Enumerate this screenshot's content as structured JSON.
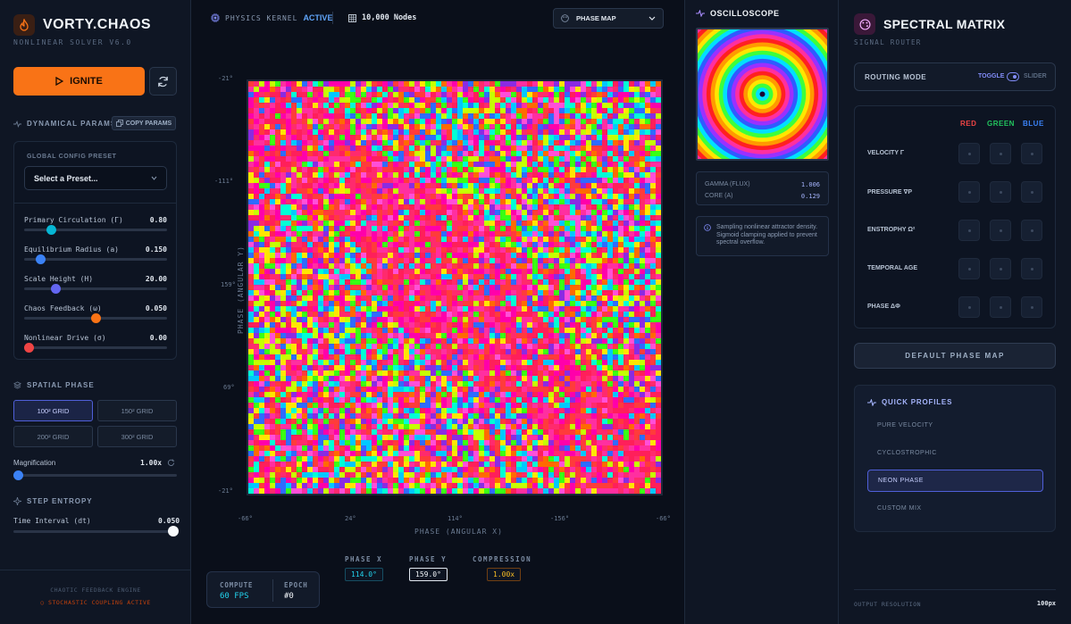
{
  "brand": {
    "title": "VORTY.CHAOS",
    "subtitle": "NONLINEAR SOLVER V6.0"
  },
  "controls": {
    "ignite_label": "IGNITE",
    "copy_params_label": "COPY PARAMS"
  },
  "sections": {
    "dynamical": "DYNAMICAL PARAMS",
    "spatial": "SPATIAL PHASE",
    "entropy": "STEP ENTROPY"
  },
  "preset": {
    "label": "GLOBAL CONFIG PRESET",
    "value": "Select a Preset..."
  },
  "params": [
    {
      "label": "Primary Circulation (Γ)",
      "value": "0.80",
      "fraction": 0.19,
      "color": "#06b6d4"
    },
    {
      "label": "Equilibrium Radius (a)",
      "value": "0.150",
      "fraction": 0.11,
      "color": "#3b82f6"
    },
    {
      "label": "Scale Height (H)",
      "value": "20.00",
      "fraction": 0.22,
      "color": "#6366f1"
    },
    {
      "label": "Chaos Feedback (ω)",
      "value": "0.050",
      "fraction": 0.5,
      "color": "#f97316"
    },
    {
      "label": "Nonlinear Drive (σ)",
      "value": "0.00",
      "fraction": 0.0,
      "color": "#ef4444"
    }
  ],
  "grid_options": [
    "100² GRID",
    "150² GRID",
    "200² GRID",
    "300² GRID"
  ],
  "magnification": {
    "label": "Magnification",
    "value": "1.00x",
    "fraction": 0.0
  },
  "time_interval": {
    "label": "Time Interval (dt)",
    "value": "0.050",
    "fraction": 1.0
  },
  "footer": {
    "line1": "CHAOTIC FEEDBACK ENGINE",
    "line2": "STOCHASTIC COUPLING ACTIVE"
  },
  "topbar": {
    "kernel_label": "PHYSICS KERNEL",
    "kernel_status": "ACTIVE",
    "nodes": "10,000 Nodes",
    "view_select": "PHASE MAP"
  },
  "plot": {
    "xlabel": "PHASE (ANGULAR X)",
    "ylabel": "PHASE (ANGULAR Y)",
    "yticks": [
      "-21°",
      "-111°",
      "159°",
      "69°",
      "-21°"
    ],
    "xticks": [
      "-66°",
      "24°",
      "114°",
      "-156°",
      "-66°"
    ]
  },
  "stats": {
    "compute_label": "COMPUTE",
    "compute_value": "60 FPS",
    "epoch_label": "EPOCH",
    "epoch_value": "#0"
  },
  "readouts": [
    {
      "label": "PHASE X",
      "value": "114.0°",
      "color": "#22d3ee",
      "border": "#164e63"
    },
    {
      "label": "PHASE Y",
      "value": "159.0°",
      "color": "#f1f5f9",
      "border": "#e2e8f0"
    },
    {
      "label": "COMPRESSION",
      "value": "1.00x",
      "color": "#fbbf24",
      "border": "#713f12"
    }
  ],
  "oscilloscope": {
    "title": "OSCILLOSCOPE",
    "metrics": [
      {
        "label": "GAMMA (FLUX)",
        "value": "1.006"
      },
      {
        "label": "CORE (A)",
        "value": "0.129"
      }
    ],
    "note": "Sampling nonlinear attractor density. Sigmoid clamping applied to prevent spectral overflow."
  },
  "spectral": {
    "title": "SPECTRAL MATRIX",
    "subtitle": "SIGNAL ROUTER",
    "routing_label": "ROUTING MODE",
    "toggle_label": "TOGGLE",
    "slider_label": "SLIDER",
    "columns": [
      {
        "label": "RED",
        "color": "#ef4444"
      },
      {
        "label": "GREEN",
        "color": "#22c55e"
      },
      {
        "label": "BLUE",
        "color": "#3b82f6"
      }
    ],
    "rows": [
      "VELOCITY Γ",
      "PRESSURE ∇P",
      "ENSTROPHY Ω²",
      "TEMPORAL AGE",
      "PHASE ΔΦ"
    ],
    "default_button": "DEFAULT PHASE MAP",
    "quick_profiles_title": "QUICK PROFILES",
    "profiles": [
      "PURE VELOCITY",
      "CYCLOSTROPHIC",
      "NEON PHASE",
      "CUSTOM MIX"
    ],
    "active_profile": 2,
    "output_label": "OUTPUT RESOLUTION",
    "output_value": "100px"
  }
}
